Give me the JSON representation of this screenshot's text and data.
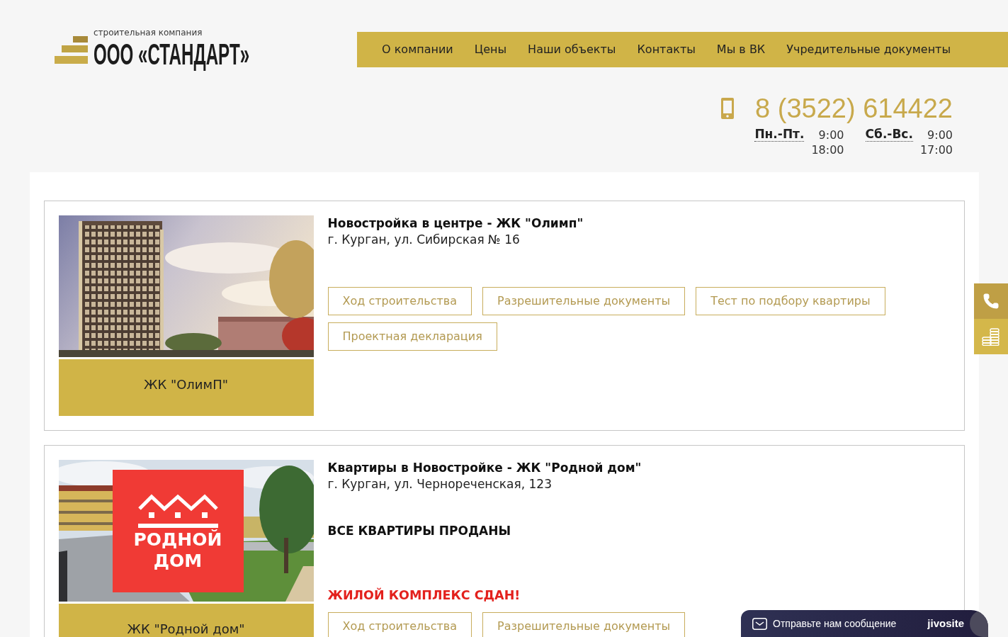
{
  "header": {
    "logo": {
      "tagline": "строительная компания",
      "name": "ООО «СТАНДАРТ»"
    },
    "nav": [
      {
        "label": "О компании"
      },
      {
        "label": "Цены"
      },
      {
        "label": "Наши объекты"
      },
      {
        "label": "Контакты"
      },
      {
        "label": "Мы в ВК"
      },
      {
        "label": "Учредительные документы"
      }
    ]
  },
  "contacts": {
    "phone": "8 (3522) 614422",
    "hours": [
      {
        "days": "Пн.-Пт.",
        "from": "9:00",
        "to": "18:00"
      },
      {
        "days": "Сб.-Вс.",
        "from": "9:00",
        "to": "17:00"
      }
    ]
  },
  "objects": [
    {
      "title": "Новостройка в центре - ЖК \"Олимп\"",
      "address": "г. Курган, ул. Сибирская № 16",
      "caption": "ЖК \"ОлимП\"",
      "buttons": [
        "Ход строительства",
        "Разрешительные документы",
        "Тест по подбору квартиры",
        "Проектная декларация"
      ]
    },
    {
      "title": "Квартиры в Новостройке - ЖК \"Родной дом\"",
      "address": "г. Курган, ул. Чернореченская, 123",
      "image_logo": "РОДНОЙ ДОМ",
      "caption": "ЖК \"Родной дом\"",
      "notes": [
        {
          "kind": "sold",
          "text": "ВСЕ КВАРТИРЫ ПРОДАНЫ"
        },
        {
          "kind": "done",
          "text": "ЖИЛОЙ КОМПЛЕКС СДАН!"
        }
      ],
      "buttons": [
        "Ход строительства",
        "Разрешительные документы"
      ]
    }
  ],
  "chat": {
    "label": "Отправьте нам сообщение",
    "brand": "jivosite"
  }
}
